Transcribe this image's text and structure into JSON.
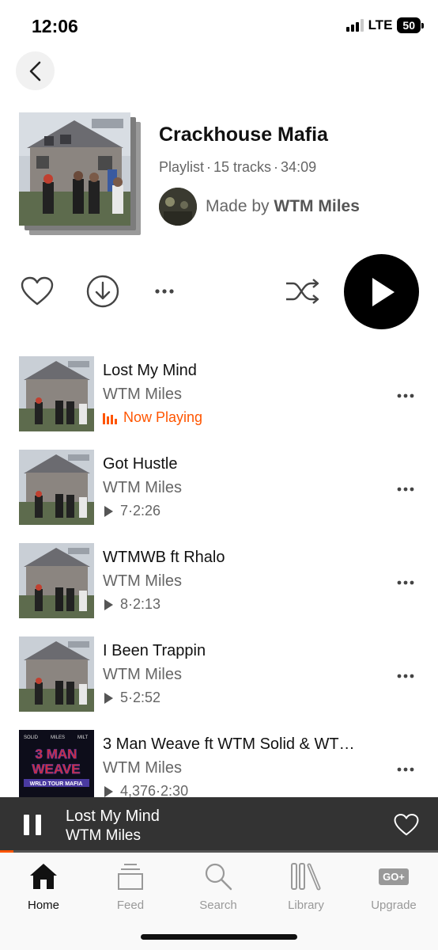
{
  "status_bar": {
    "time": "12:06",
    "network": "LTE",
    "battery": "50"
  },
  "playlist": {
    "title": "Crackhouse Mafia",
    "type": "Playlist",
    "tracks_count": "15 tracks",
    "duration": "34:09",
    "separator": "·",
    "made_by_prefix": "Made by",
    "creator": "WTM Miles"
  },
  "tracks": [
    {
      "title": "Lost My Mind",
      "artist": "WTM Miles",
      "status": "Now Playing",
      "playing": true
    },
    {
      "title": "Got Hustle",
      "artist": "WTM Miles",
      "plays": "7",
      "duration": "2:26"
    },
    {
      "title": "WTMWB ft Rhalo",
      "artist": "WTM Miles",
      "plays": "8",
      "duration": "2:13"
    },
    {
      "title": "I Been Trappin",
      "artist": "WTM Miles",
      "plays": "5",
      "duration": "2:52"
    },
    {
      "title": "3 Man Weave ft WTM Solid & WT…",
      "artist": "WTM Miles",
      "plays": "4,376",
      "duration": "2:30"
    }
  ],
  "track5_art": {
    "line1": "SOLID",
    "line2": "MILES",
    "line3": "MILT",
    "big1": "3 MAN",
    "big2": "WEAVE",
    "footer": "WRLD TOUR MAFIA"
  },
  "mini_player": {
    "title": "Lost My Mind",
    "artist": "WTM Miles",
    "progress": 0.03
  },
  "tabs": [
    {
      "label": "Home",
      "icon": "home-icon",
      "active": true
    },
    {
      "label": "Feed",
      "icon": "feed-icon"
    },
    {
      "label": "Search",
      "icon": "search-icon"
    },
    {
      "label": "Library",
      "icon": "library-icon"
    },
    {
      "label": "Upgrade",
      "icon": "upgrade-icon",
      "badge": "GO+"
    }
  ],
  "colors": {
    "accent": "#ff5500",
    "mini_player_bg": "#333333"
  }
}
